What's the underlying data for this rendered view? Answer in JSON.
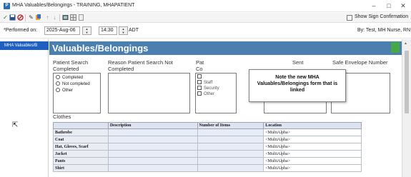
{
  "window": {
    "title": "MHA Valuables/Belongings - TRAINING, MHAPATIENT",
    "app_icon": "P",
    "minimize_glyph": "–",
    "maximize_glyph": "□",
    "close_glyph": "✕"
  },
  "toolbar": {
    "icons": [
      "checkmark-icon",
      "save-icon",
      "cancel-icon",
      "edit-icon",
      "attach-icon",
      "up-arrow-icon",
      "down-arrow-icon",
      "image-icon",
      "grid-icon",
      "document-icon"
    ],
    "show_sign_confirmation_label": "Show Sign Confirmation"
  },
  "performed": {
    "label": "*Performed on:",
    "date": "2025-Aug-06",
    "time": "14:30",
    "adt_label": "ADT",
    "by_label": "By:  Test, MH Nurse, RN"
  },
  "nav": {
    "items": [
      "MHA Valuables/B"
    ]
  },
  "form": {
    "title": "Valuables/Belongings",
    "columns": {
      "patient_search_completed": "Patient Search Completed",
      "reason_not_completed": "Reason Patient Search Not Completed",
      "patient_search_conducted_by": "Pat Co",
      "consent": "Sent",
      "safe_envelope": "Safe Envelope Number"
    },
    "search_options": [
      "Completed",
      "Not completed",
      "Other"
    ],
    "conducted_by_options": [
      "",
      "Staff",
      "Security",
      "Other"
    ],
    "tooltip": "Note the new MHA Valuables/Belongings form that is linked"
  },
  "clothes": {
    "label": "Clothes",
    "headers": [
      "",
      "Description",
      "Number of Items",
      "Location"
    ],
    "rows": [
      {
        "item": "Bathrobe",
        "location": "<MultiAlpha>"
      },
      {
        "item": "Coat",
        "location": "<MultiAlpha>"
      },
      {
        "item": "Hat, Gloves, Scarf",
        "location": "<MultiAlpha>"
      },
      {
        "item": "Jacket",
        "location": "<MultiAlpha>"
      },
      {
        "item": "Pants",
        "location": "<MultiAlpha>"
      },
      {
        "item": "Shirt",
        "location": "<MultiAlpha>"
      }
    ]
  },
  "colors": {
    "form_header": "#4a7fb0",
    "nav_selected": "#1e5fc0",
    "status_green": "#46a847"
  }
}
